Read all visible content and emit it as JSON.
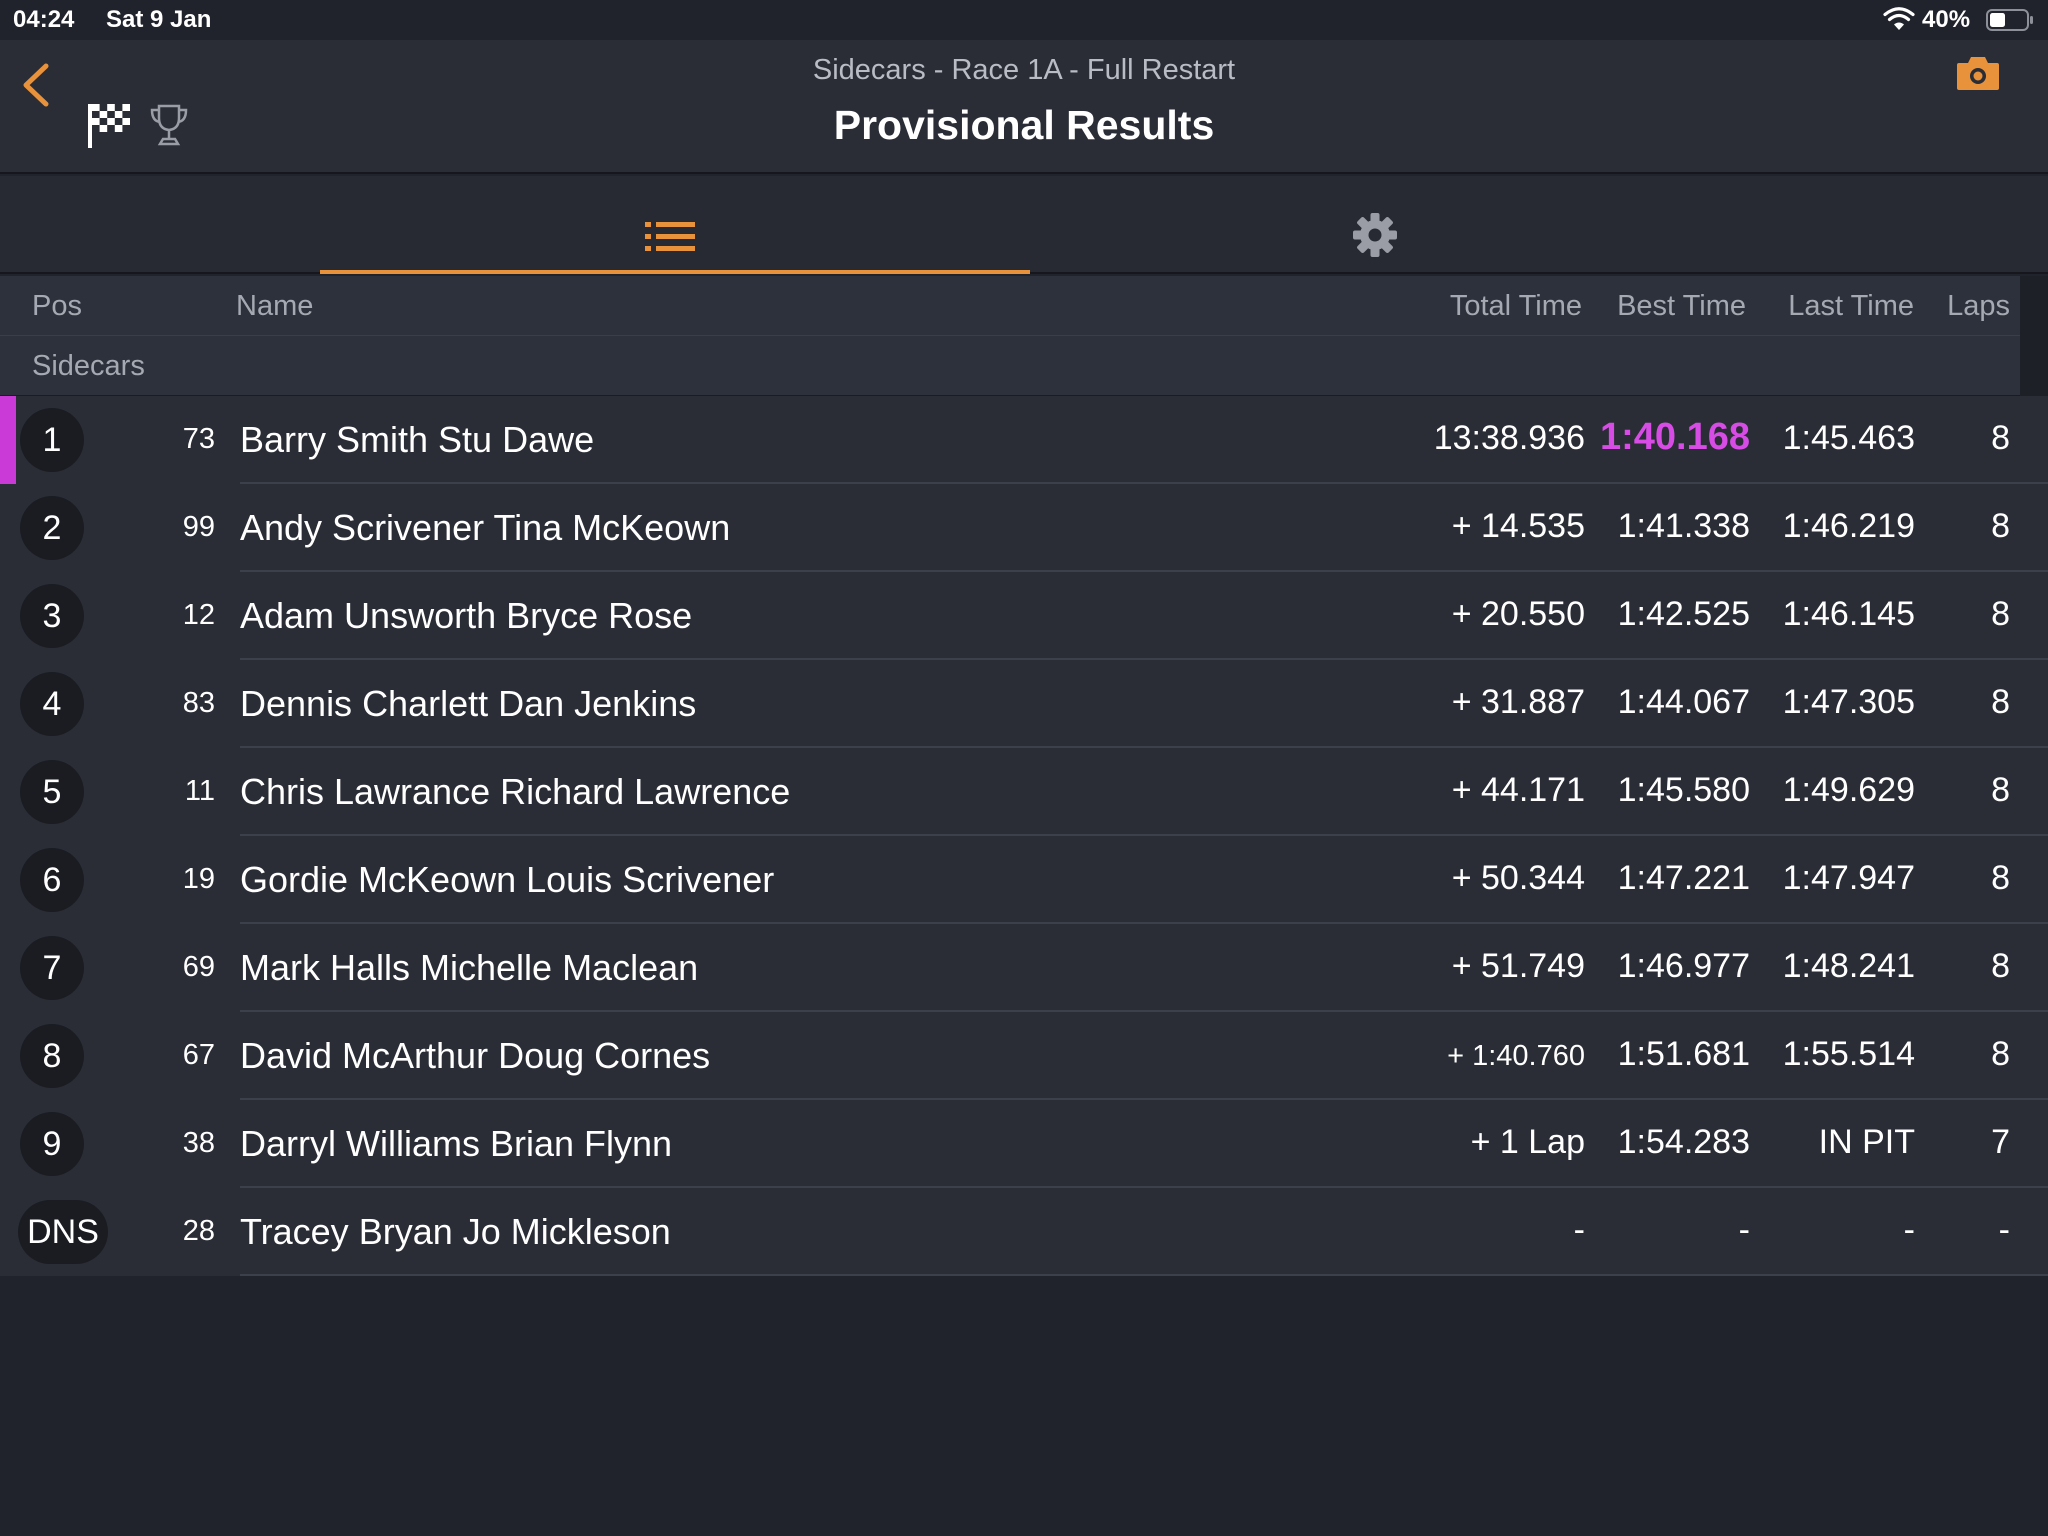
{
  "status_bar": {
    "time": "04:24",
    "date": "Sat 9 Jan",
    "battery": "40%"
  },
  "header": {
    "subtitle": "Sidecars - Race 1A - Full Restart",
    "title": "Provisional Results",
    "icons": [
      "back-chevron-icon",
      "checkered-flag-icon",
      "trophy-icon",
      "camera-icon"
    ]
  },
  "tabs": [
    {
      "icon": "list-icon",
      "selected": true
    },
    {
      "icon": "gear-icon",
      "selected": false
    }
  ],
  "columns": {
    "pos": "Pos",
    "name": "Name",
    "total": "Total Time",
    "best": "Best Time",
    "last": "Last Time",
    "laps": "Laps"
  },
  "group_label": "Sidecars",
  "colors": {
    "accent": "#e8923b",
    "fastest": "#d84ce6",
    "background": "#20232c",
    "row": "#2a2d36"
  },
  "rows": [
    {
      "pos": "1",
      "num": "73",
      "name": "Barry Smith Stu Dawe",
      "total": "13:38.936",
      "best": "1:40.168",
      "last": "1:45.463",
      "laps": "8"
    },
    {
      "pos": "2",
      "num": "99",
      "name": "Andy Scrivener Tina McKeown",
      "total": "+ 14.535",
      "best": "1:41.338",
      "last": "1:46.219",
      "laps": "8"
    },
    {
      "pos": "3",
      "num": "12",
      "name": "Adam Unsworth Bryce Rose",
      "total": "+ 20.550",
      "best": "1:42.525",
      "last": "1:46.145",
      "laps": "8"
    },
    {
      "pos": "4",
      "num": "83",
      "name": "Dennis Charlett Dan Jenkins",
      "total": "+ 31.887",
      "best": "1:44.067",
      "last": "1:47.305",
      "laps": "8"
    },
    {
      "pos": "5",
      "num": "11",
      "name": "Chris Lawrance Richard Lawrence",
      "total": "+ 44.171",
      "best": "1:45.580",
      "last": "1:49.629",
      "laps": "8"
    },
    {
      "pos": "6",
      "num": "19",
      "name": "Gordie McKeown Louis Scrivener",
      "total": "+ 50.344",
      "best": "1:47.221",
      "last": "1:47.947",
      "laps": "8"
    },
    {
      "pos": "7",
      "num": "69",
      "name": "Mark Halls Michelle Maclean",
      "total": "+ 51.749",
      "best": "1:46.977",
      "last": "1:48.241",
      "laps": "8"
    },
    {
      "pos": "8",
      "num": "67",
      "name": "David McArthur Doug Cornes",
      "total": "+ 1:40.760",
      "best": "1:51.681",
      "last": "1:55.514",
      "laps": "8"
    },
    {
      "pos": "9",
      "num": "38",
      "name": "Darryl Williams Brian Flynn",
      "total": "+ 1 Lap",
      "best": "1:54.283",
      "last": "IN PIT",
      "laps": "7"
    },
    {
      "pos": "DNS",
      "num": "28",
      "name": "Tracey Bryan Jo Mickleson",
      "total": "-",
      "best": "-",
      "last": "-",
      "laps": "-"
    }
  ]
}
